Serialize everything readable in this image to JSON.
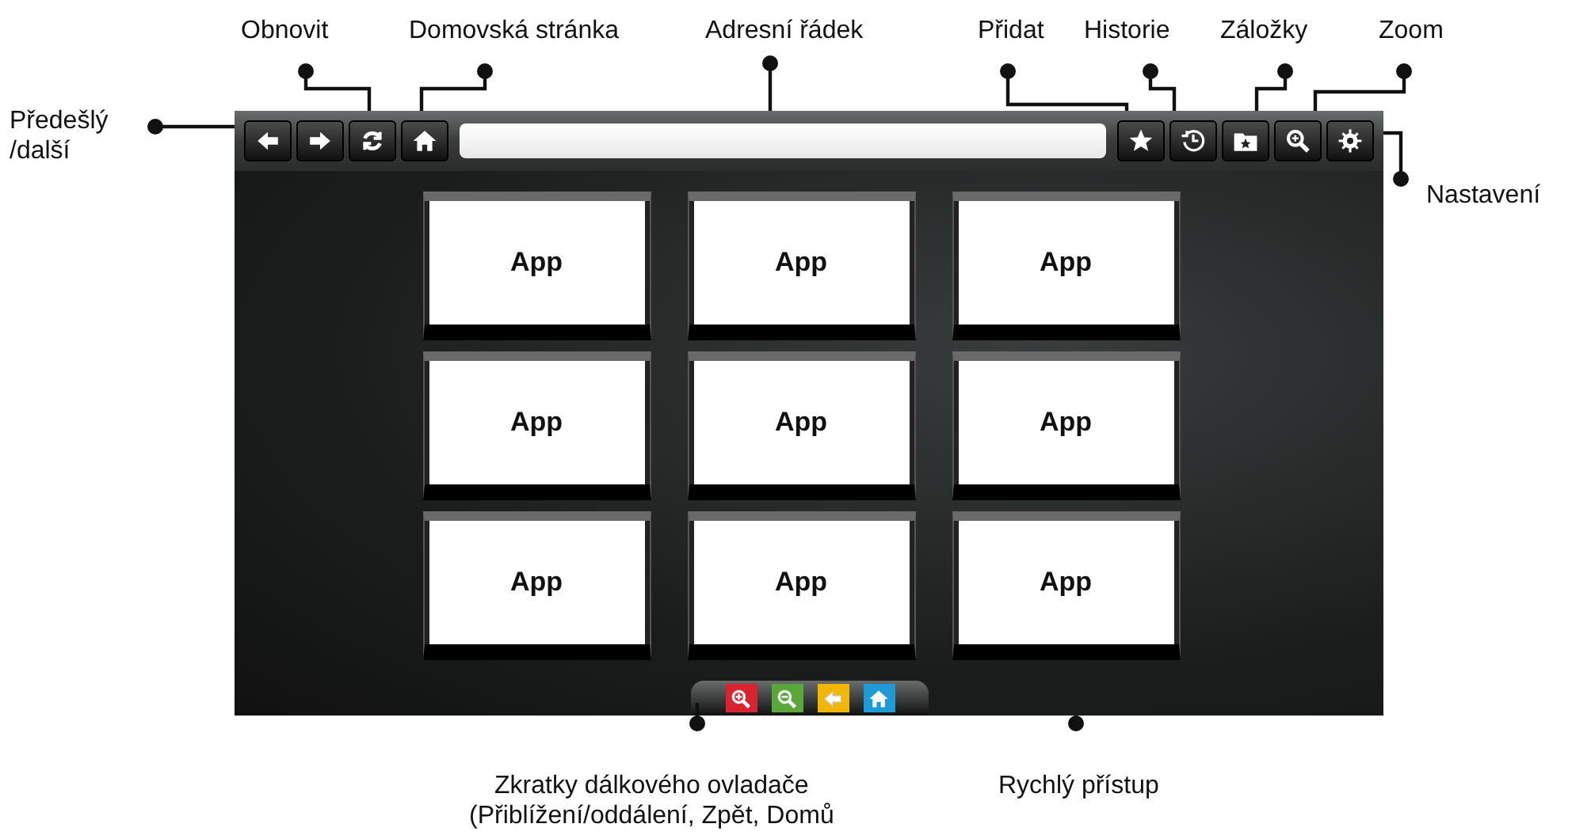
{
  "callouts": [
    {
      "kind": "top",
      "text": "Obnovit"
    },
    {
      "kind": "top",
      "text": "Domovská stránka"
    },
    {
      "kind": "top",
      "text": "Adresní řádek"
    },
    {
      "kind": "top",
      "text": "Přidat"
    },
    {
      "kind": "top",
      "text": "Historie"
    },
    {
      "kind": "top",
      "text": "Záložky"
    },
    {
      "kind": "top",
      "text": "Zoom"
    },
    {
      "kind": "side",
      "text": "Předešlý\n/další"
    },
    {
      "kind": "side",
      "text": "Nastavení"
    },
    {
      "kind": "bottom",
      "text": "Zkratky dálkového ovladače\n(Přiblížení/oddálení, Zpět, Domů"
    },
    {
      "kind": "bottom",
      "text": "Rychlý přístup"
    }
  ],
  "toolbar": {
    "left_buttons": [
      {
        "kind": "back"
      },
      {
        "kind": "forward"
      },
      {
        "kind": "refresh"
      },
      {
        "kind": "home"
      }
    ],
    "right_buttons": [
      {
        "kind": "star"
      },
      {
        "kind": "history"
      },
      {
        "kind": "bookmarks"
      },
      {
        "kind": "zoom"
      },
      {
        "kind": "settings"
      }
    ]
  },
  "tiles": [
    {
      "label": "App"
    },
    {
      "label": "App"
    },
    {
      "label": "App"
    },
    {
      "label": "App"
    },
    {
      "label": "App"
    },
    {
      "label": "App"
    },
    {
      "label": "App"
    },
    {
      "label": "App"
    },
    {
      "label": "App"
    }
  ],
  "shortcuts": [
    {
      "kind": "zoom-in",
      "color": "#d9232e"
    },
    {
      "kind": "zoom-out",
      "color": "#5aa83a"
    },
    {
      "kind": "back",
      "color": "#f2b705"
    },
    {
      "kind": "home",
      "color": "#1e9ad6"
    }
  ]
}
